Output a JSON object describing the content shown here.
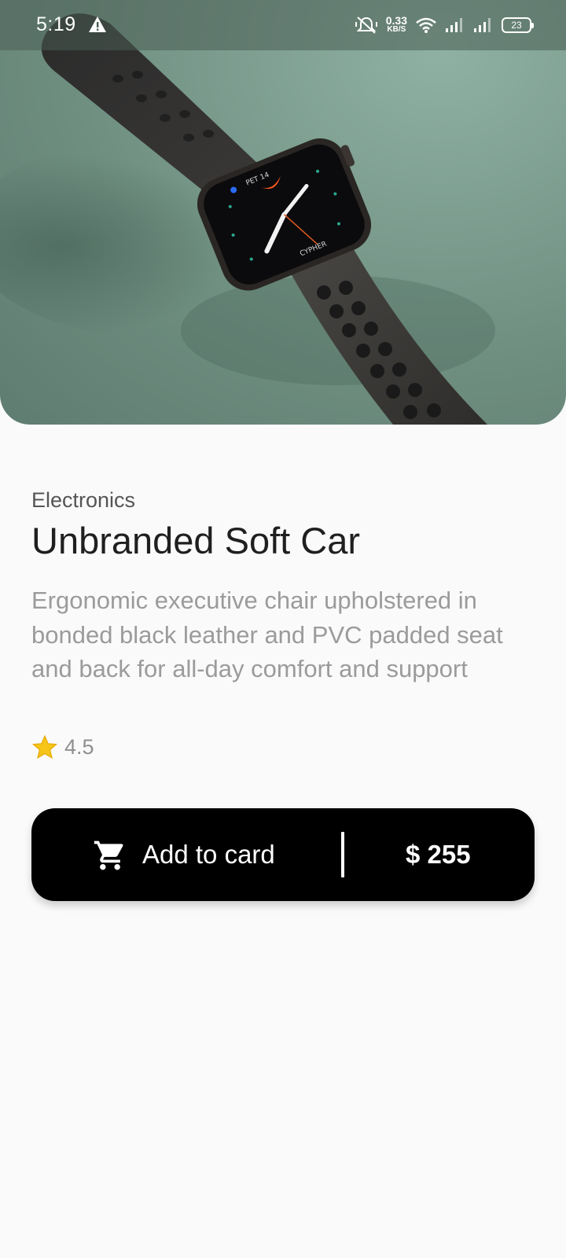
{
  "status_bar": {
    "time": "5:19",
    "network_speed_value": "0.33",
    "network_speed_unit": "KB/S",
    "battery_level": "23",
    "icons": [
      "alert-icon",
      "mute-icon",
      "wifi-icon",
      "signal-icon",
      "signal-icon",
      "battery-icon"
    ]
  },
  "hero": {
    "icon": "smartwatch-photo",
    "watch_face_date": "PET 14",
    "watch_face_label": "CYPHER"
  },
  "product": {
    "category": "Electronics",
    "title": "Unbranded Soft Car",
    "description": "Ergonomic executive chair upholstered in bonded black leather and PVC padded seat and back for all-day comfort and support",
    "rating": "4.5",
    "rating_icon": "star-icon"
  },
  "cart_button": {
    "label": "Add to card",
    "price": "$ 255",
    "icon": "cart-icon"
  },
  "colors": {
    "background": "#fafafa",
    "button": "#000000",
    "star": "#f5c518",
    "title_text": "#1f1f1f",
    "description_text": "#9b9b9b"
  }
}
